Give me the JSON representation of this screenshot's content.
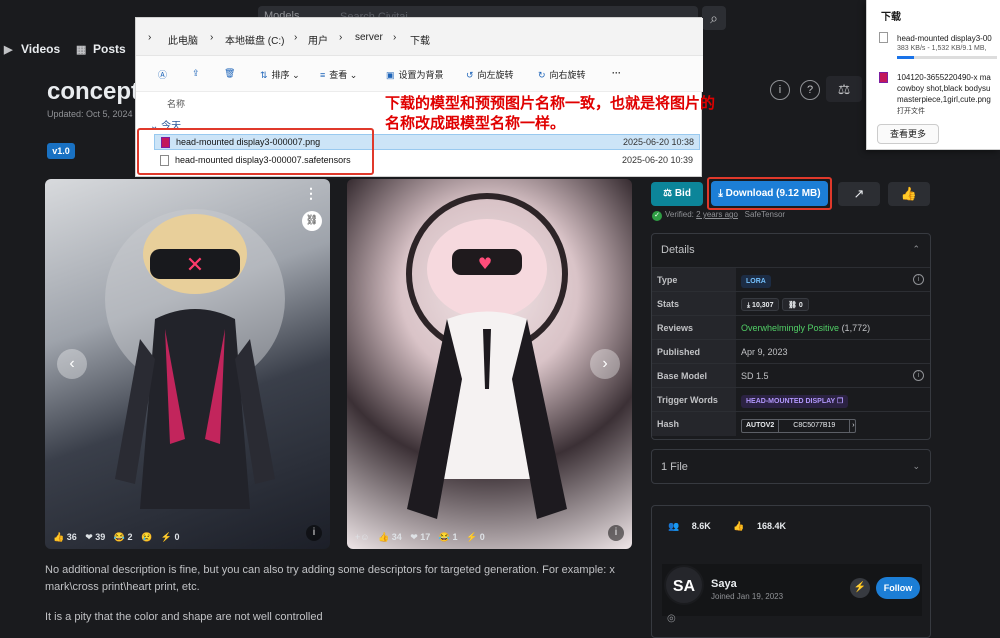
{
  "topbar": {
    "models_label": "Models",
    "search_placeholder": "Search Civitai",
    "nav": [
      {
        "label": "Videos",
        "icon": "video-icon"
      },
      {
        "label": "Posts",
        "icon": "posts-icon"
      }
    ]
  },
  "model": {
    "title": "concept",
    "updated": "Updated: Oct 5, 2024",
    "version": "v1.0"
  },
  "explorer": {
    "breadcrumb": [
      "此电脑",
      "本地磁盘 (C:)",
      "用户",
      "server",
      "下载"
    ],
    "toolbar": [
      "排序",
      "查看",
      "设置为背景",
      "向左旋转",
      "向右旋转"
    ],
    "column_name": "名称",
    "group": "今天",
    "files": [
      {
        "name": "head-mounted display3-000007.png",
        "date": "2025-06-20 10:38"
      },
      {
        "name": "head-mounted display3-000007.safetensors",
        "date": "2025-06-20 10:39"
      }
    ]
  },
  "annotation": "下载的模型和预预图片名称一致，也就是将图片的名称改成跟模型名称一样。",
  "downloads": {
    "header": "下载",
    "item1_name": "head-mounted display3-00",
    "item1_status": "383 KB/s - 1,532 KB/9.1 MB,",
    "item1_progress": 0.17,
    "item2_lines": [
      "104120-3655220490-x ma",
      "cowboy shot,black bodysu",
      "masterpiece,1girl,cute.png"
    ],
    "open_file": "打开文件",
    "see_more": "查看更多"
  },
  "images": [
    {
      "reactions": [
        "36",
        "39",
        "2",
        "",
        "0"
      ]
    },
    {
      "reactions": [
        "34",
        "17",
        "1",
        "0"
      ]
    }
  ],
  "description": {
    "p1": "No additional description is fine, but you can also try adding some descriptors for targeted generation. For example: x mark\\cross print\\heart print, etc.",
    "p2": "It is a pity that the color and shape are not well controlled"
  },
  "actions": {
    "bid": "Bid",
    "download": "Download (9.12 MB)"
  },
  "verified": {
    "label": "Verified:",
    "when": "2 years ago",
    "format": "SafeTensor"
  },
  "details": {
    "header": "Details",
    "rows": [
      {
        "key": "Type",
        "value": "LORA"
      },
      {
        "key": "Stats",
        "downloads": "10,307",
        "links": "0"
      },
      {
        "key": "Reviews",
        "value": "Overwhelmingly Positive",
        "count": "(1,772)"
      },
      {
        "key": "Published",
        "value": "Apr 9, 2023"
      },
      {
        "key": "Base Model",
        "value": "SD 1.5"
      },
      {
        "key": "Trigger Words",
        "value": "HEAD-MOUNTED DISPLAY"
      },
      {
        "key": "Hash",
        "algo": "AUTOV2",
        "value": "C8C5077B19"
      }
    ]
  },
  "files": {
    "label": "1 File"
  },
  "creator": {
    "followers": "8.6K",
    "likes": "168.4K",
    "initials": "SA",
    "name": "Saya",
    "joined": "Joined Jan 19, 2023",
    "follow": "Follow"
  },
  "colors": {
    "accent": "#1c7ed6",
    "bid": "#0c8599",
    "annotation": "#e00000"
  }
}
